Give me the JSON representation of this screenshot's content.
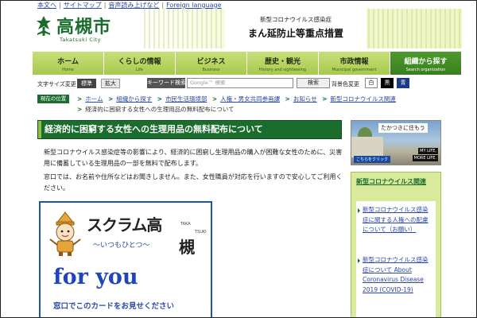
{
  "utility_links": [
    "本文へ",
    "サイトマップ",
    "音声読み上げなど",
    "Foreign language"
  ],
  "logo": {
    "name": "高槻市",
    "sub": "Takatsuki City"
  },
  "banner": {
    "line1": "新型コロナウイルス感染症",
    "line2": "まん延防止等重点措置"
  },
  "nav": [
    {
      "ja": "ホーム",
      "en": "Home"
    },
    {
      "ja": "くらしの情報",
      "en": "Life"
    },
    {
      "ja": "ビジネス",
      "en": "Business"
    },
    {
      "ja": "歴史・観光",
      "en": "History and sightseeing"
    },
    {
      "ja": "市政情報",
      "en": "Municipal government"
    },
    {
      "ja": "組織から探す",
      "en": "Search organization"
    }
  ],
  "tools": {
    "font_size_label": "文字サイズ変更",
    "standard": "標準",
    "enlarge": "拡大",
    "keyword_label": "キーワード検索",
    "search_placeholder": "Google™ 検索",
    "search_button": "検索",
    "bg_color_label": "背景色変更",
    "bg_white": "白",
    "bg_black": "黒",
    "bg_blue": "青"
  },
  "breadcrumb": {
    "badge": "現在の位置",
    "items": [
      "ホーム",
      "組織から探す",
      "市民生活環境部",
      "人権・男女共同参画課",
      "お知らせ",
      "新型コロナウイルス関連"
    ],
    "current": "経済的に困窮する女性への生理用品の無料配布について"
  },
  "main": {
    "title": "経済的に困窮する女性への生理用品の無料配布について",
    "para1": "新型コロナウイルス感染症等の影響により、経済的に困窮し生理用品の購入が困難な女性のために、災害用に備蓄している生理用品の一部を無料で配布します。",
    "para2": "窓口では、お名前や住所などはお聞きしません。また、女性職員が対応を行いますので安心してご利用ください。"
  },
  "card": {
    "scrum": "スクラム高",
    "taka": "TAKA",
    "tsuki": "TSUKI",
    "kanji": "槻",
    "tagline": "～いつもひとつ～",
    "for_you": "for you",
    "note": "窓口でこのカードをお見せください"
  },
  "side_banner": {
    "heading": "たかつきに住もう",
    "my_life": "MY LIFE,",
    "more_life": "MORE LIFE.",
    "click": "こちらをクリック"
  },
  "side_box": {
    "title": "新型コロナウイルス関連",
    "links": [
      "新型コロナウイルス感染症に関する人権への配慮について（お願い）",
      "新型コロナウイルス感染症について About Coronavirus Disease 2019 (COVID-19)"
    ]
  }
}
